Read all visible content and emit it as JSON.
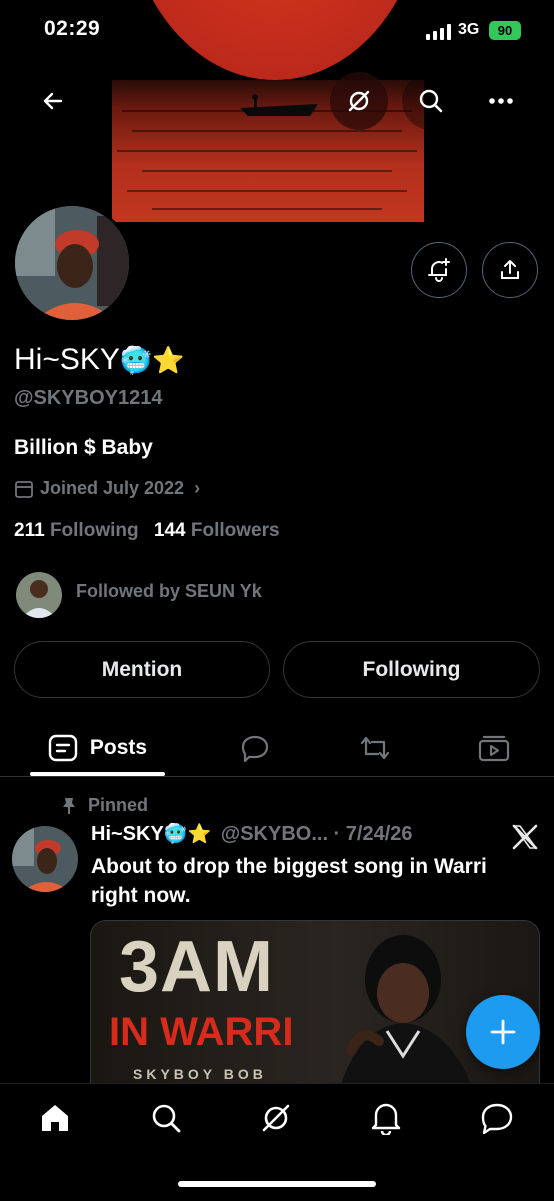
{
  "status_bar": {
    "time": "02:29",
    "network": "3G",
    "battery": "90"
  },
  "header": {
    "back_icon": "arrow-left-icon",
    "grok_icon": "grok-icon",
    "search_icon": "search-icon",
    "more_icon": "more-horizontal-icon"
  },
  "profile": {
    "display_name": "Hi~SKY",
    "emojis": "🥶⭐",
    "handle": "@SKYBOY1214",
    "bio": "Billion $ Baby",
    "joined": "Joined July 2022",
    "following_count": "211",
    "following_label": "Following",
    "followers_count": "144",
    "followers_label": "Followers",
    "followed_by": "Followed by SEUN Yk"
  },
  "actions": {
    "mention_label": "Mention",
    "following_label": "Following"
  },
  "tabs": [
    {
      "label": "Posts",
      "icon": "posts-icon",
      "active": true
    },
    {
      "label": "",
      "icon": "replies-icon",
      "active": false
    },
    {
      "label": "",
      "icon": "repost-icon",
      "active": false
    },
    {
      "label": "",
      "icon": "media-icon",
      "active": false
    }
  ],
  "post": {
    "pinned_label": "Pinned",
    "author": "Hi~SKY",
    "author_emojis": "🥶⭐",
    "handle_date": "@SKYBO... · 7/24/26",
    "text": "About to drop the biggest song in Warri right now.",
    "media": {
      "line1": "3AM",
      "line2": "IN WARRI",
      "line3": "SKYBOY BOB"
    }
  },
  "fab_icon": "plus-icon",
  "bottom_nav": [
    "home-icon",
    "search-icon",
    "grok-icon",
    "bell-icon",
    "messages-icon"
  ],
  "colors": {
    "accent": "#1d9bf0",
    "muted": "#71767b",
    "border": "#333639"
  }
}
